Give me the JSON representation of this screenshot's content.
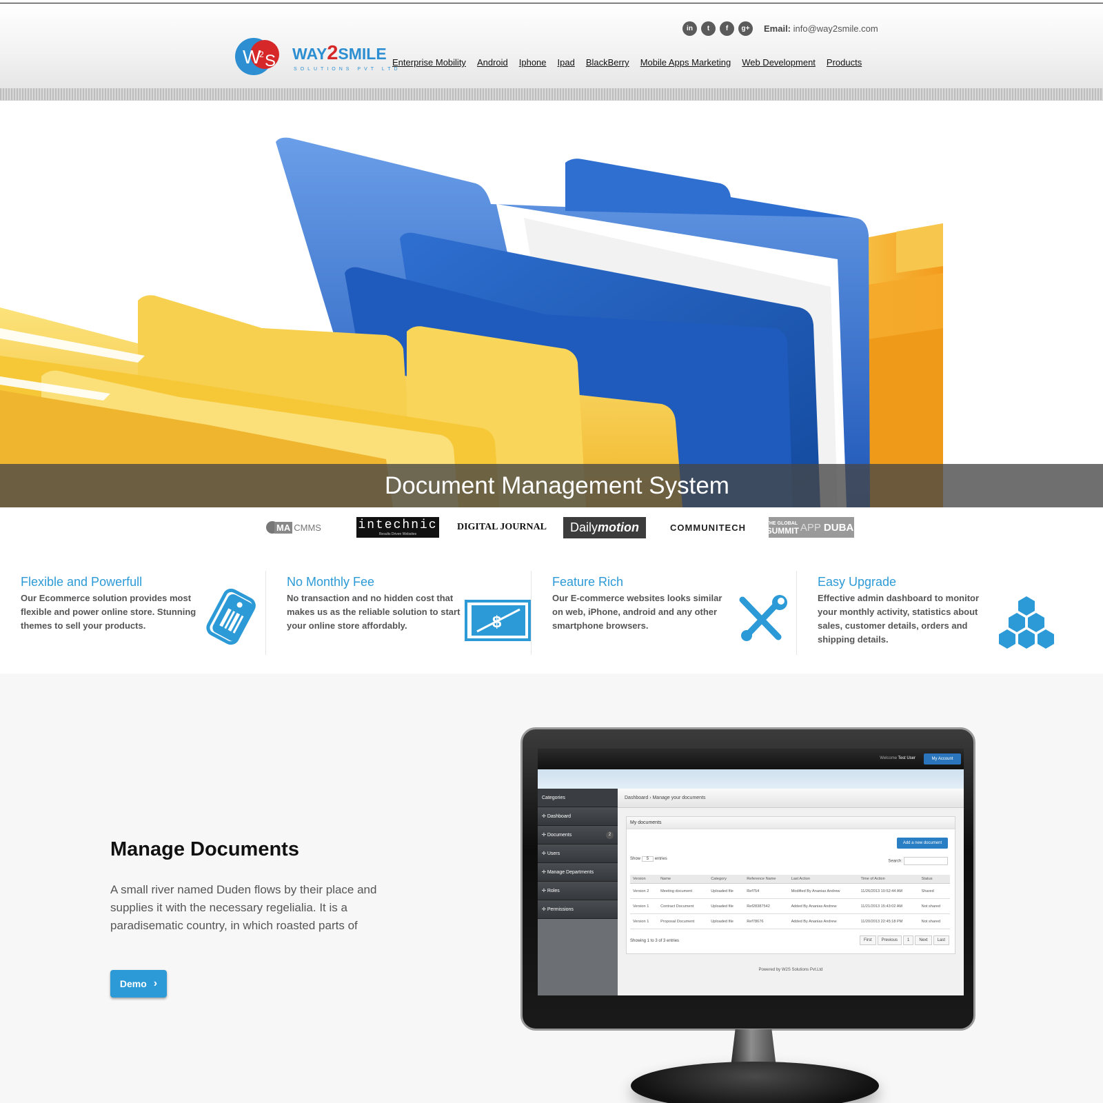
{
  "brand": {
    "initials_w": "W",
    "initials_2": "2",
    "initials_s": "S",
    "name_pre": "WAY",
    "name_two": "2",
    "name_post": "SMILE",
    "tagline": "SOLUTIONS PVT LTD"
  },
  "header": {
    "social": [
      {
        "icon": "linkedin-icon",
        "glyph": "in"
      },
      {
        "icon": "twitter-icon",
        "glyph": "t"
      },
      {
        "icon": "facebook-icon",
        "glyph": "f"
      },
      {
        "icon": "google-plus-icon",
        "glyph": "g+"
      }
    ],
    "email_label": "Email:",
    "email_value": "info@way2smile.com",
    "nav": [
      "Enterprise Mobility",
      "Android",
      "Iphone",
      "Ipad",
      "BlackBerry",
      "Mobile Apps Marketing",
      "Web Development",
      "Products"
    ]
  },
  "hero": {
    "caption": "Document Management System"
  },
  "partners": {
    "macmms_ma": "MA",
    "macmms_rest": "CMMS",
    "intechnic": "intechnic",
    "intechnic_sub": "Results Driven Websites",
    "digital_journal": "DIGITAL JOURNAL",
    "dailymotion_daily": "Daily",
    "dailymotion_motion": "motion",
    "communitech": "COMMUNITECH",
    "summit_line1": "THE GLOBAL",
    "summit_line2": "SUMMIT",
    "summit_app": "APP",
    "summit_city": "DUBAI"
  },
  "features": [
    {
      "title": "Flexible and Powerfull",
      "text": "Our Ecommerce solution provides most flexible and power online store. Stunning themes to sell your products.",
      "icon": "price-tag-icon"
    },
    {
      "title": "No Monthly Fee",
      "text": "No transaction and no hidden cost that makes us as the reliable solution to start your online store affordably.",
      "icon": "dollar-bill-icon"
    },
    {
      "title": "Feature Rich",
      "text": "Our E-commerce websites looks similar on web, iPhone, android and any other smartphone browsers.",
      "icon": "tools-icon"
    },
    {
      "title": "Easy Upgrade",
      "text": "Effective admin dashboard to monitor your monthly activity, statistics about sales, customer details, orders and shipping details.",
      "icon": "hexagon-stack-icon"
    }
  ],
  "manage": {
    "title": "Manage Documents",
    "text": "A small river named Duden flows by their place and supplies it with the necessary regelialia. It is a paradisematic country, in which roasted parts of",
    "demo_label": "Demo"
  },
  "screen": {
    "welcome_label": "Welcome",
    "welcome_user": "Test User",
    "account": "My Account",
    "categories": "Categories",
    "side_items": [
      "Dashboard",
      "Documents",
      "Users",
      "Manage Departments",
      "Roles",
      "Permissions"
    ],
    "documents_badge": "2",
    "breadcrumb": "Dashboard › Manage your documents",
    "panel_title": "My documents",
    "add_button": "Add a new document",
    "show_label": "Show",
    "show_value": "5",
    "entries_label": "entries",
    "search_label": "Search:",
    "columns": [
      "Version",
      "Name",
      "Category",
      "Reference Name",
      "Last Action",
      "Time of Action",
      "Status"
    ],
    "rows": [
      [
        "Version 2",
        "Meeting document",
        "Uploaded file",
        "Ref754",
        "Modified By Ananias Andrew",
        "11/26/2013 10:52:44 AM",
        "Shared"
      ],
      [
        "Version 1",
        "Contract Document",
        "Uploaded file",
        "Ref28387542",
        "Added By Ananias Andrew",
        "11/21/2013 15:43:02 AM",
        "Not shared"
      ],
      [
        "Version 1",
        "Proposal Document",
        "Uploaded file",
        "Ref78676",
        "Added By Ananias Andrew",
        "11/20/2013 22:45:18 PM",
        "Not shared"
      ]
    ],
    "showing": "Showing 1 to 3 of 3 entries",
    "pager": [
      "First",
      "Previous",
      "1",
      "Next",
      "Last"
    ],
    "footer": "Powered by W2S Solutions Pvt.Ltd"
  },
  "colors": {
    "accent": "#2b9ad6",
    "logo_red": "#d62828",
    "folder_blue": "#2f6fd0",
    "folder_yellow": "#f7c93c"
  }
}
